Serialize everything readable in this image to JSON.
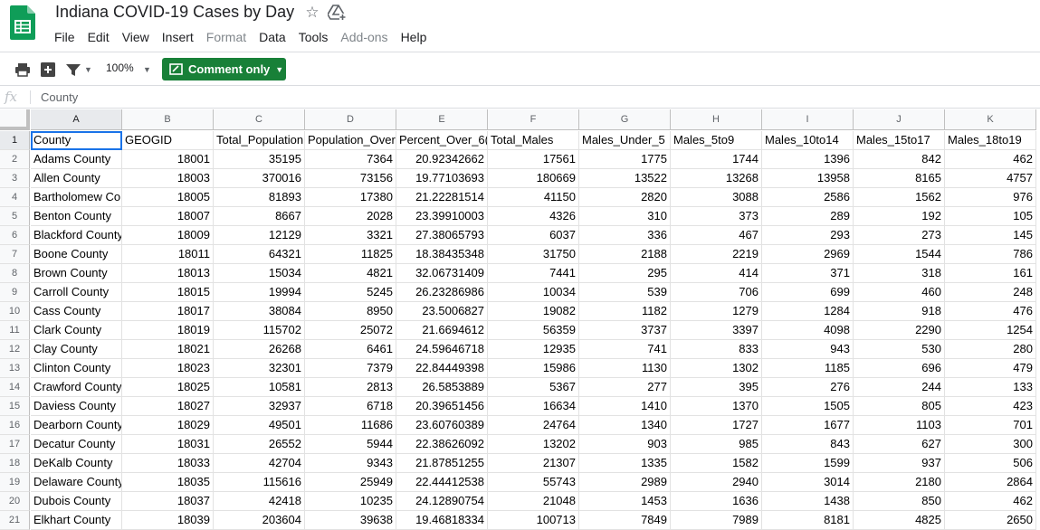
{
  "app": {
    "doc_title": "Indiana COVID-19 Cases by Day",
    "star_icon": "star-icon",
    "drive_icon": "move-to-drive-icon"
  },
  "menu": [
    "File",
    "Edit",
    "View",
    "Insert",
    "Format",
    "Data",
    "Tools",
    "Add-ons",
    "Help"
  ],
  "menu_disabled": [
    "Format",
    "Add-ons"
  ],
  "toolbar": {
    "zoom": "100%",
    "comment_button": "Comment only",
    "accent_color": "#188038"
  },
  "formula_bar": {
    "fx_label": "fx",
    "value": "County"
  },
  "grid": {
    "columns": [
      "A",
      "B",
      "C",
      "D",
      "E",
      "F",
      "G",
      "H",
      "I",
      "J",
      "K"
    ],
    "row_numbers": [
      "1",
      "2",
      "3",
      "4",
      "5",
      "6",
      "7",
      "8",
      "9",
      "10",
      "11",
      "12",
      "13",
      "14",
      "15",
      "16",
      "17",
      "18",
      "19",
      "20",
      "21"
    ],
    "header_row": [
      "County",
      "GEOGID",
      "Total_Population",
      "Population_Over",
      "Percent_Over_6(",
      "Total_Males",
      "Males_Under_5",
      "Males_5to9",
      "Males_10to14",
      "Males_15to17",
      "Males_18to19"
    ],
    "rows": [
      [
        "Adams County",
        "18001",
        "35195",
        "7364",
        "20.92342662",
        "17561",
        "1775",
        "1744",
        "1396",
        "842",
        "462"
      ],
      [
        "Allen County",
        "18003",
        "370016",
        "73156",
        "19.77103693",
        "180669",
        "13522",
        "13268",
        "13958",
        "8165",
        "4757"
      ],
      [
        "Bartholomew Co",
        "18005",
        "81893",
        "17380",
        "21.22281514",
        "41150",
        "2820",
        "3088",
        "2586",
        "1562",
        "976"
      ],
      [
        "Benton County",
        "18007",
        "8667",
        "2028",
        "23.39910003",
        "4326",
        "310",
        "373",
        "289",
        "192",
        "105"
      ],
      [
        "Blackford County",
        "18009",
        "12129",
        "3321",
        "27.38065793",
        "6037",
        "336",
        "467",
        "293",
        "273",
        "145"
      ],
      [
        "Boone County",
        "18011",
        "64321",
        "11825",
        "18.38435348",
        "31750",
        "2188",
        "2219",
        "2969",
        "1544",
        "786"
      ],
      [
        "Brown County",
        "18013",
        "15034",
        "4821",
        "32.06731409",
        "7441",
        "295",
        "414",
        "371",
        "318",
        "161"
      ],
      [
        "Carroll County",
        "18015",
        "19994",
        "5245",
        "26.23286986",
        "10034",
        "539",
        "706",
        "699",
        "460",
        "248"
      ],
      [
        "Cass County",
        "18017",
        "38084",
        "8950",
        "23.5006827",
        "19082",
        "1182",
        "1279",
        "1284",
        "918",
        "476"
      ],
      [
        "Clark County",
        "18019",
        "115702",
        "25072",
        "21.6694612",
        "56359",
        "3737",
        "3397",
        "4098",
        "2290",
        "1254"
      ],
      [
        "Clay County",
        "18021",
        "26268",
        "6461",
        "24.59646718",
        "12935",
        "741",
        "833",
        "943",
        "530",
        "280"
      ],
      [
        "Clinton County",
        "18023",
        "32301",
        "7379",
        "22.84449398",
        "15986",
        "1130",
        "1302",
        "1185",
        "696",
        "479"
      ],
      [
        "Crawford County",
        "18025",
        "10581",
        "2813",
        "26.5853889",
        "5367",
        "277",
        "395",
        "276",
        "244",
        "133"
      ],
      [
        "Daviess County",
        "18027",
        "32937",
        "6718",
        "20.39651456",
        "16634",
        "1410",
        "1370",
        "1505",
        "805",
        "423"
      ],
      [
        "Dearborn County",
        "18029",
        "49501",
        "11686",
        "23.60760389",
        "24764",
        "1340",
        "1727",
        "1677",
        "1103",
        "701"
      ],
      [
        "Decatur County",
        "18031",
        "26552",
        "5944",
        "22.38626092",
        "13202",
        "903",
        "985",
        "843",
        "627",
        "300"
      ],
      [
        "DeKalb County",
        "18033",
        "42704",
        "9343",
        "21.87851255",
        "21307",
        "1335",
        "1582",
        "1599",
        "937",
        "506"
      ],
      [
        "Delaware County",
        "18035",
        "115616",
        "25949",
        "22.44412538",
        "55743",
        "2989",
        "2940",
        "3014",
        "2180",
        "2864"
      ],
      [
        "Dubois County",
        "18037",
        "42418",
        "10235",
        "24.12890754",
        "21048",
        "1453",
        "1636",
        "1438",
        "850",
        "462"
      ],
      [
        "Elkhart County",
        "18039",
        "203604",
        "39638",
        "19.46818334",
        "100713",
        "7849",
        "7989",
        "8181",
        "4825",
        "2650"
      ]
    ]
  }
}
